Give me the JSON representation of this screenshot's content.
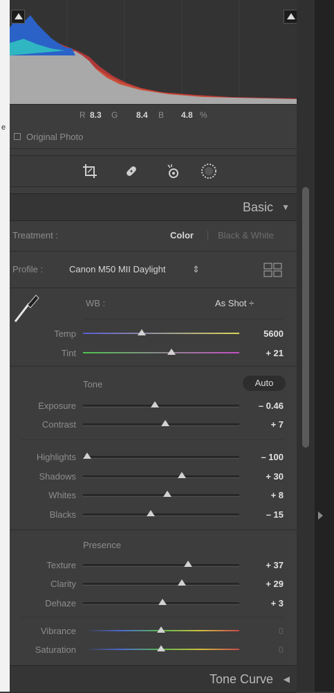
{
  "histogram": {
    "r_label": "R",
    "r_value": "8.3",
    "g_label": "G",
    "g_value": "8.4",
    "b_label": "B",
    "b_value": "4.8",
    "unit": "%",
    "original_photo_label": "Original Photo"
  },
  "left_edge_char": "e",
  "basic": {
    "title": "Basic",
    "treatment_label": "Treatment :",
    "treatment_color": "Color",
    "treatment_bw": "Black & White",
    "profile_label": "Profile :",
    "profile_value": "Canon M50 MII Daylight",
    "profile_arrow": "⇕",
    "wb_label": "WB :",
    "wb_value": "As Shot ÷",
    "tone_label": "Tone",
    "auto_label": "Auto",
    "presence_label": "Presence"
  },
  "sliders": [
    {
      "label": "Temp",
      "value": "5600",
      "level": 0.37
    },
    {
      "label": "Tint",
      "value": "+ 21",
      "level": 0.57
    },
    {
      "label": "Exposure",
      "value": "– 0.46",
      "level": 0.46
    },
    {
      "label": "Contrast",
      "value": "+ 7",
      "level": 0.53
    },
    {
      "label": "Highlights",
      "value": "– 100",
      "level": 0.0
    },
    {
      "label": "Shadows",
      "value": "+ 30",
      "level": 0.64
    },
    {
      "label": "Whites",
      "value": "+ 8",
      "level": 0.54
    },
    {
      "label": "Blacks",
      "value": "– 15",
      "level": 0.43
    },
    {
      "label": "Texture",
      "value": "+ 37",
      "level": 0.68
    },
    {
      "label": "Clarity",
      "value": "+ 29",
      "level": 0.64
    },
    {
      "label": "Dehaze",
      "value": "+ 3",
      "level": 0.51
    },
    {
      "label": "Vibrance",
      "value": "0",
      "level": 0.5
    },
    {
      "label": "Saturation",
      "value": "0",
      "level": 0.5
    }
  ],
  "tone_curve": {
    "title": "Tone Curve"
  },
  "colors": {
    "temp_left": "#5b5bd4",
    "temp_right": "#d8d45a",
    "tint_left": "#4fc44f",
    "tint_right": "#c64ec6"
  }
}
